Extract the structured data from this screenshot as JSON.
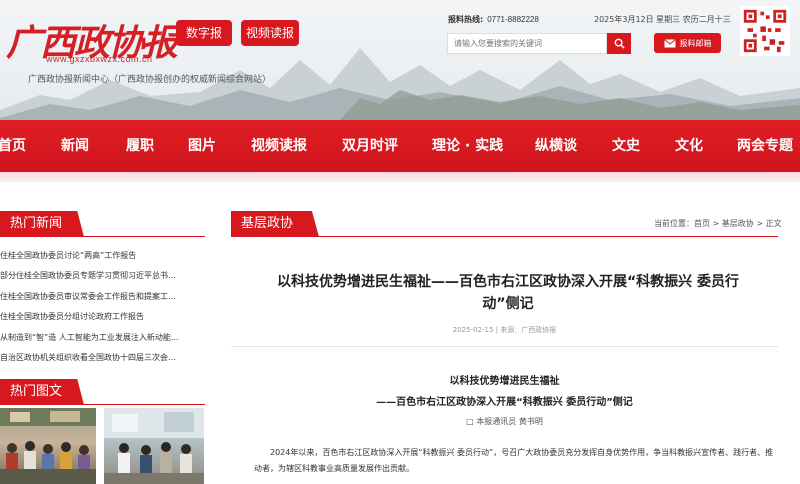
{
  "header": {
    "logo_text": "广西政协报",
    "logo_url": "www.gxzxbxwzx.com.cn",
    "site_desc": "广西政协报新闻中心（广西政协报创办的权威新闻综合网站）",
    "btn_digital": "数字报",
    "btn_video": "视频读报",
    "hotline_label": "报料热线:",
    "hotline_number": "0771-8882228",
    "datetime": "2025年3月12日 星期三 农历二月十三",
    "search_placeholder": "请输入您要搜索的关键词",
    "mail_label": "报料邮箱"
  },
  "nav": {
    "items": [
      "首页",
      "新闻",
      "履职",
      "图片",
      "视频读报",
      "双月时评",
      "理论 · 实践",
      "纵横谈",
      "文史",
      "文化",
      "两会专题"
    ]
  },
  "left": {
    "hot_news_title": "热门新闻",
    "hot_news": [
      "住桂全国政协委员讨论“两高”工作报告",
      "部分住桂全国政协委员专题学习贯彻习近平总书...",
      "住桂全国政协委员审议常委会工作报告和提案工...",
      "住桂全国政协委员分组讨论政府工作报告",
      "从制造到“智”造 人工智能为工业发展注入新动能...",
      "自治区政协机关组织收看全国政协十四届三次会..."
    ],
    "hot_pics_title": "热门图文"
  },
  "right": {
    "section_title": "基层政协",
    "breadcrumb": "当前位置：首页 > 基层政协 > 正文",
    "article_title": "以科技优势增进民生福祉——百色市右江区政协深入开展“科教振兴 委员行动”侧记",
    "meta": "2025-02-15 | 来源：广西政协报",
    "sub_title_1": "以科技优势增进民生福祉",
    "sub_title_2": "——百色市右江区政协深入开展“科教振兴 委员行动”侧记",
    "byline": "□ 本报通讯员 黄书明",
    "body": "2024年以来，百色市右江区政协深入开展“科教振兴 委员行动”，号召广大政协委员充分发挥自身优势作用，争当科教振兴宣传者、践行者、推动者，为辖区科教事业高质量发展作出贡献。"
  },
  "colors": {
    "brand_red": "#d7191f",
    "nav_red": "#e01f26"
  }
}
